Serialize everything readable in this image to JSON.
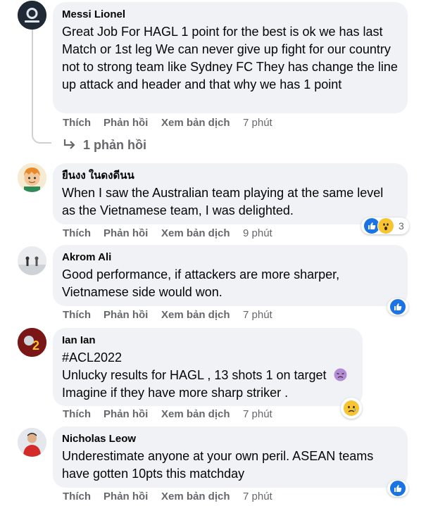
{
  "comments": [
    {
      "author": "Messi Lionel",
      "text": "Great Job For HAGL 1 point for the best is ok we has last Match or 1st leg We can never give up fight for our country not to strong team like Sydney FC They has change the line up attack and header and that why we has 1 point",
      "like": "Thích",
      "reply": "Phản hồi",
      "translate": "Xem bản dịch",
      "time": "7 phút",
      "replies_label": "1 phản hồi"
    },
    {
      "author": "ยืนงง ในดงดีนน",
      "text": "When I saw the Australian team playing at the same level as the Vietnamese team, I was delighted.",
      "like": "Thích",
      "reply": "Phản hồi",
      "translate": "Xem bản dịch",
      "time": "9 phút",
      "reaction_count": "3"
    },
    {
      "author": "Akrom Ali",
      "text": "Good performance, if attackers are more sharper, Vietnamese side would won.",
      "like": "Thích",
      "reply": "Phản hồi",
      "translate": "Xem bản dịch",
      "time": "7 phút"
    },
    {
      "author": "Ian Ian",
      "hashtag": "#ACL2022",
      "line1": "Unlucky results for HAGL , 13 shots 1 on target",
      "line2": "Imagine if they have more sharp striker .",
      "like": "Thích",
      "reply": "Phản hồi",
      "translate": "Xem bản dịch",
      "time": "7 phút"
    },
    {
      "author": "Nicholas Leow",
      "text": "Underestimate anyone at your own peril. ASEAN teams have gotten 10pts this matchday",
      "like": "Thích",
      "reply": "Phản hồi",
      "translate": "Xem bản dịch",
      "time": "7 phút"
    }
  ],
  "colors": {
    "bubble": "#f0f2f5",
    "meta": "#65676b",
    "like_blue": "#1b74e4"
  },
  "icons": [
    "reply-arrow-icon",
    "like-reaction-icon",
    "wow-reaction-icon",
    "sad-reaction-icon",
    "tired-emoji-icon"
  ]
}
